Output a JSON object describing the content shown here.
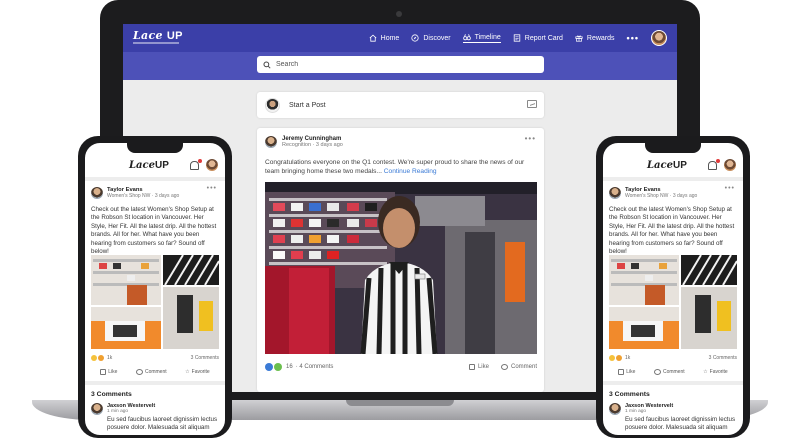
{
  "app": {
    "logo_main": "Lace",
    "logo_up": "UP",
    "nav": [
      {
        "label": "Home",
        "icon": "home-icon"
      },
      {
        "label": "Discover",
        "icon": "compass-icon"
      },
      {
        "label": "Timeline",
        "icon": "binoculars-icon",
        "active": true
      },
      {
        "label": "Report Card",
        "icon": "report-card-icon"
      },
      {
        "label": "Rewards",
        "icon": "gift-icon"
      }
    ],
    "more": "•••",
    "search_placeholder": "Search",
    "start_post": "Start a Post",
    "accent_color": "#3b3fa8"
  },
  "feed_post": {
    "author": "Jeremy Cunningham",
    "meta": "Recognition · 3 days ago",
    "text": "Congratulations everyone on the Q1 contest. We're super proud to share the news of our team bringing home these two medals...",
    "continue": "Continue Reading",
    "reaction_count": "16",
    "comment_count": "· 4 Comments",
    "like": "Like",
    "comment": "Comment",
    "menu": "•••"
  },
  "mobile_post": {
    "author": "Taylor Evans",
    "meta": "Women's Shop NW · 3 days ago",
    "text": "Check out the latest Women's Shop Setup at the Robson St location in Vancouver. Her Style, Her Fit. All the latest drip. All the hottest brands. All for her. What have you been hearing from customers so far? Sound off below!",
    "reaction_count": "1k",
    "comments_count": "3 Comments",
    "like": "Like",
    "comment": "Comment",
    "favorite": "Favorite",
    "comments_title": "3 Comments",
    "comment_author": "Jaxson Westervelt",
    "comment_meta": "1 min ago",
    "comment_text": "Eu sed faucibus laoreet dignissim lectus posuere dolor. Malesuada sit aliquam",
    "menu": "•••"
  }
}
